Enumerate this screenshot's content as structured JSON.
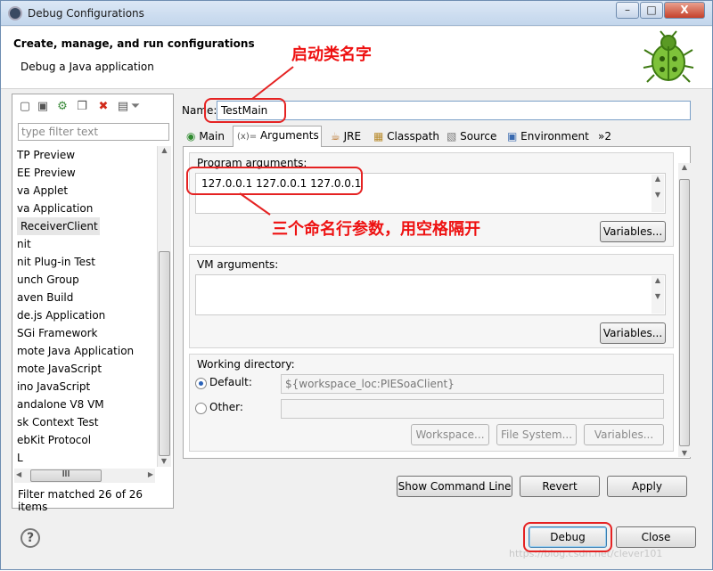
{
  "window": {
    "title": "Debug Configurations",
    "minimize": "–",
    "maximize": "□",
    "close": "X"
  },
  "header": {
    "title": "Create, manage, and run configurations",
    "subtitle": "Debug a Java application"
  },
  "annotations": {
    "name_note": "启动类名字",
    "args_note": "三个命名行参数，用空格隔开"
  },
  "left": {
    "filter_placeholder": "type filter text",
    "items": [
      "TP Preview",
      "EE Preview",
      "va Applet",
      "va Application",
      "ReceiverClient",
      "nit",
      "nit Plug-in Test",
      "unch Group",
      "aven Build",
      "de.js Application",
      "SGi Framework",
      "mote Java Application",
      "mote JavaScript",
      "ino JavaScript",
      "andalone V8 VM",
      "sk Context Test",
      "ebKit Protocol",
      "L"
    ],
    "hscroll_grip": "III",
    "status": "Filter matched 26 of 26 items"
  },
  "right": {
    "name_label": "Name:",
    "name_value": "TestMain",
    "tabs": [
      "Main",
      "Arguments",
      "JRE",
      "Classpath",
      "Source",
      "Environment",
      "»2"
    ],
    "program_args_label": "Program arguments:",
    "program_args_value": "127.0.0.1 127.0.0.1 127.0.0.1",
    "variables_label": "Variables...",
    "vm_args_label": "VM arguments:",
    "vm_args_value": "",
    "working_dir_label": "Working directory:",
    "default_label": "Default:",
    "default_value": "${workspace_loc:PIESoaClient}",
    "other_label": "Other:",
    "other_value": "",
    "workspace_btn": "Workspace...",
    "filesystem_btn": "File System...",
    "variables_btn": "Variables...",
    "show_cmd": "Show Command Line",
    "revert": "Revert",
    "apply": "Apply"
  },
  "footer": {
    "help": "?",
    "debug": "Debug",
    "close": "Close",
    "watermark": "https://blog.csdn.net/clever101"
  }
}
